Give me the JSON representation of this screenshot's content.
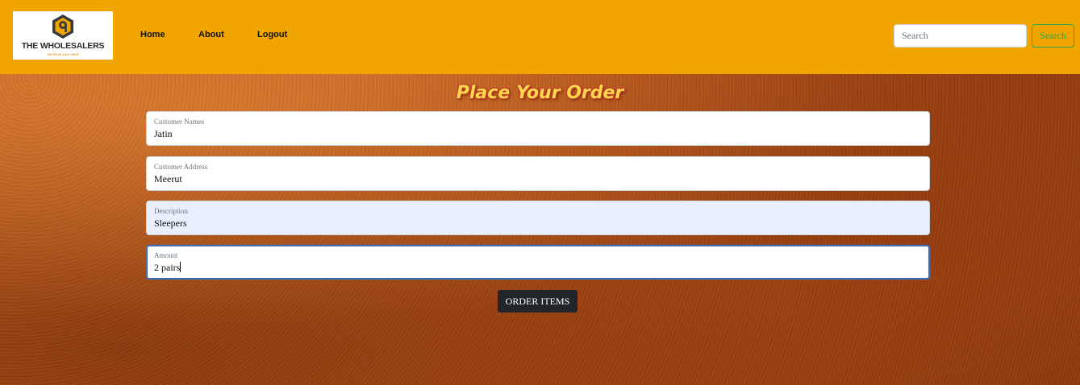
{
  "navbar": {
    "logo": {
      "title": "THE WHOLESALERS",
      "tagline": "we know your need"
    },
    "links": [
      {
        "label": "Home"
      },
      {
        "label": "About"
      },
      {
        "label": "Logout"
      }
    ],
    "search": {
      "placeholder": "Search",
      "value": "",
      "button_label": "Search"
    },
    "background_color": "#f0a500"
  },
  "form": {
    "heading": "Place Your Order",
    "fields": [
      {
        "label": "Customer Names",
        "value": "Jatin"
      },
      {
        "label": "Customer Address",
        "value": "Meerut"
      },
      {
        "label": "Description",
        "value": "Sleepers",
        "state": "autofilled"
      },
      {
        "label": "Amount",
        "value": "2 pairs",
        "state": "focused"
      }
    ],
    "submit_label": "ORDER ITEMS"
  },
  "colors": {
    "heading": "#ffd84a",
    "heading_outline": "#c0392b",
    "search_button": "#28a745",
    "submit_button": "#212529",
    "focus_border": "#3d6fb6",
    "autofill_background": "#e8f0fe"
  },
  "icons": [
    "logo-hexagon-icon"
  ]
}
